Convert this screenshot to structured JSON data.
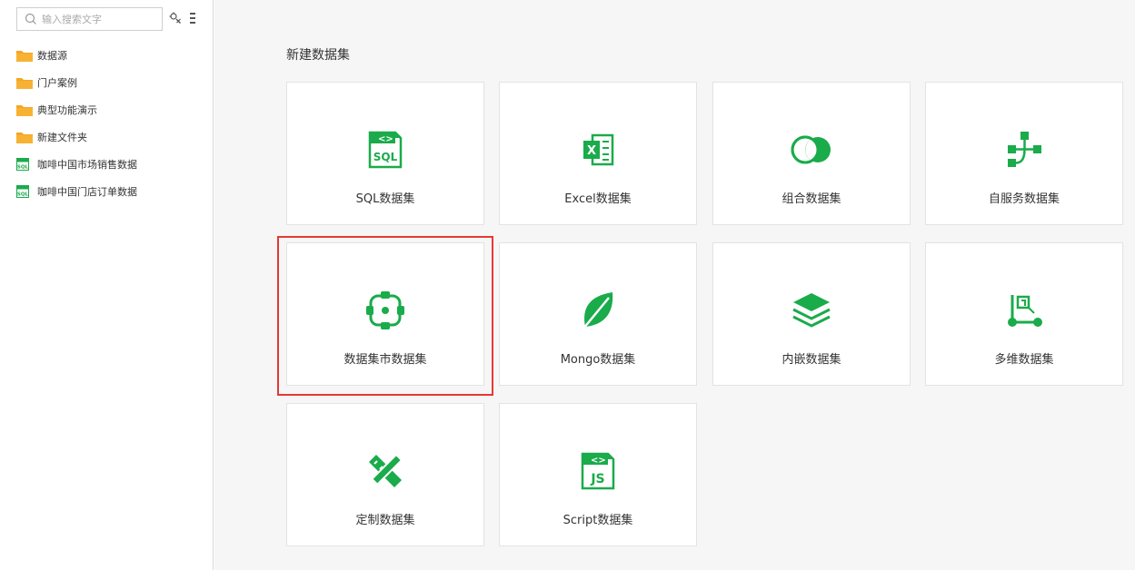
{
  "sidebar": {
    "search_placeholder": "输入搜索文字",
    "items": [
      {
        "label": "数据源",
        "icon": "folder-icon"
      },
      {
        "label": "门户案例",
        "icon": "folder-icon"
      },
      {
        "label": "典型功能演示",
        "icon": "folder-icon"
      },
      {
        "label": "新建文件夹",
        "icon": "folder-icon"
      },
      {
        "label": "咖啡中国市场销售数据",
        "icon": "sql-file-icon"
      },
      {
        "label": "咖啡中国门店订单数据",
        "icon": "sql-file-icon"
      }
    ]
  },
  "main": {
    "title": "新建数据集",
    "cards": [
      {
        "label": "SQL数据集",
        "icon": "sql-file-icon"
      },
      {
        "label": "Excel数据集",
        "icon": "excel-file-icon"
      },
      {
        "label": "组合数据集",
        "icon": "combine-circles-icon"
      },
      {
        "label": "自服务数据集",
        "icon": "flow-tree-icon"
      },
      {
        "label": "数据集市数据集",
        "icon": "data-mart-icon"
      },
      {
        "label": "Mongo数据集",
        "icon": "leaf-icon"
      },
      {
        "label": "内嵌数据集",
        "icon": "layers-icon"
      },
      {
        "label": "多维数据集",
        "icon": "cube-axes-icon"
      },
      {
        "label": "定制数据集",
        "icon": "pencil-ruler-icon"
      },
      {
        "label": "Script数据集",
        "icon": "js-file-icon"
      }
    ]
  },
  "colors": {
    "accent": "#1aab4b",
    "folder": "#f5a623",
    "highlight": "#e53935"
  }
}
